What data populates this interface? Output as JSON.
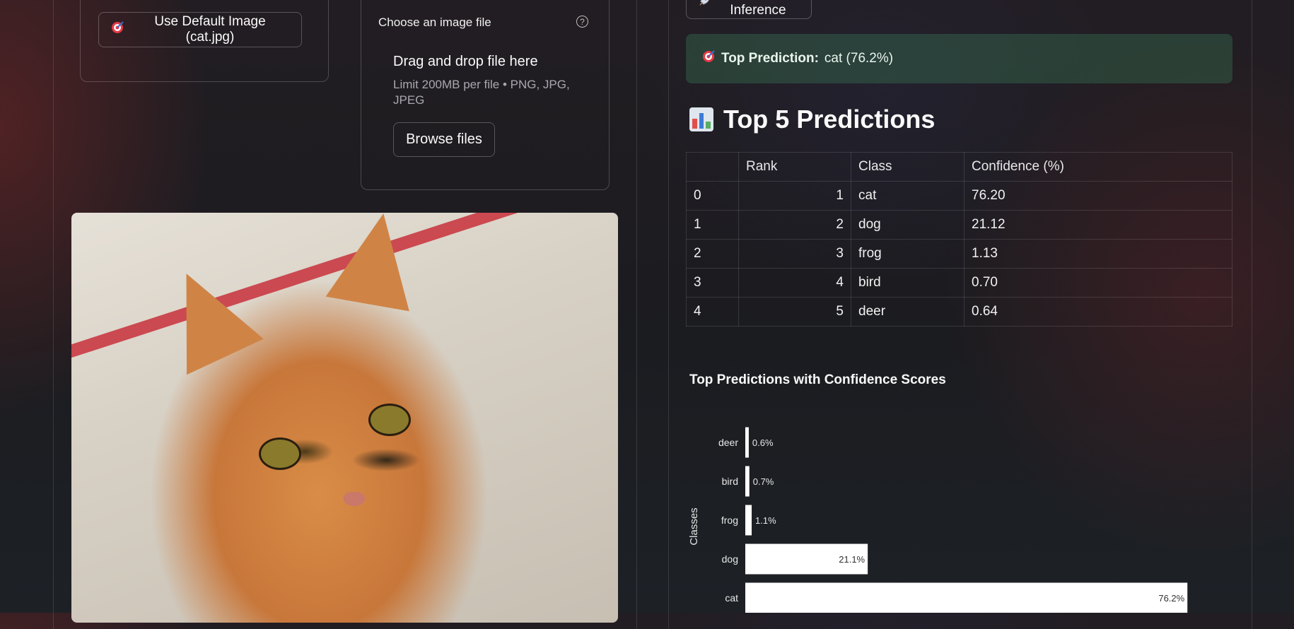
{
  "left": {
    "default_button": {
      "icon": "target-icon",
      "label": "Use Default Image (cat.jpg)"
    },
    "uploader": {
      "label": "Choose an image file",
      "drop_title": "Drag and drop file here",
      "limit_text": "Limit 200MB per file • PNG, JPG, JPEG",
      "browse_label": "Browse files"
    }
  },
  "right": {
    "run_button": {
      "icon": "rocket-icon",
      "label": "Run Inference"
    },
    "alert": {
      "prefix": "Top Prediction:",
      "value": "cat (76.2%)"
    },
    "section_title": "Top 5 Predictions",
    "table": {
      "columns": [
        "",
        "Rank",
        "Class",
        "Confidence (%)"
      ],
      "rows": [
        [
          "0",
          "1",
          "cat",
          "76.20"
        ],
        [
          "1",
          "2",
          "dog",
          "21.12"
        ],
        [
          "2",
          "3",
          "frog",
          "1.13"
        ],
        [
          "3",
          "4",
          "bird",
          "0.70"
        ],
        [
          "4",
          "5",
          "deer",
          "0.64"
        ]
      ]
    }
  },
  "chart_data": {
    "type": "bar",
    "orientation": "horizontal",
    "title": "Top Predictions with Confidence Scores",
    "ylabel": "Classes",
    "categories": [
      "deer",
      "bird",
      "frog",
      "dog",
      "cat"
    ],
    "values": [
      0.6,
      0.7,
      1.1,
      21.1,
      76.2
    ],
    "value_labels": [
      "0.6%",
      "0.7%",
      "1.1%",
      "21.1%",
      "76.2%"
    ],
    "xlim": [
      0,
      78
    ],
    "bar_color": "#ffffff",
    "grid": false
  }
}
